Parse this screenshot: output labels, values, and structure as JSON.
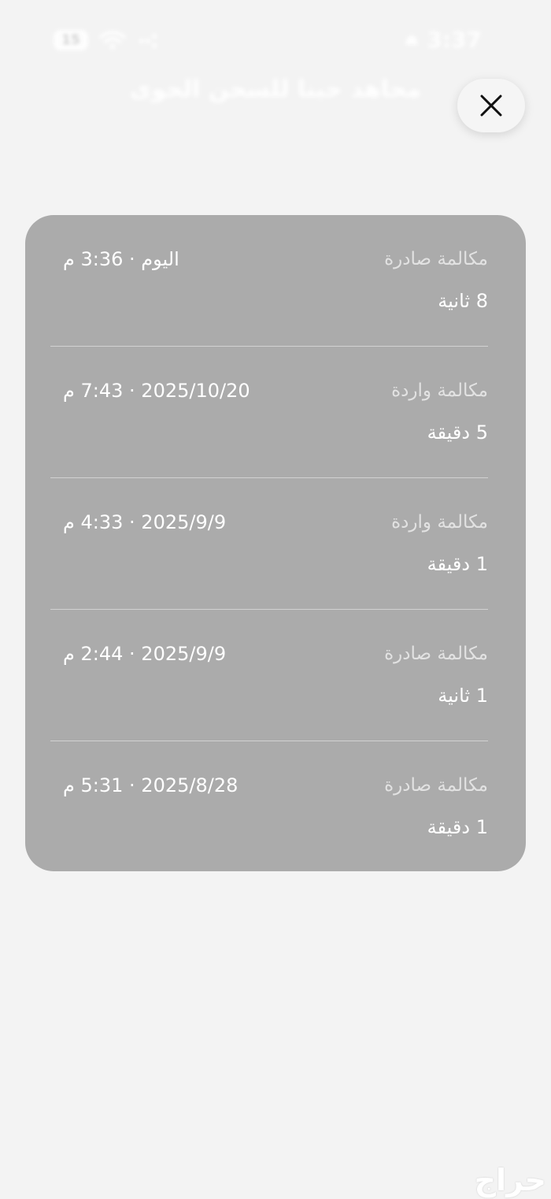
{
  "status_bar": {
    "time": "3:37",
    "battery": "15"
  },
  "contact": {
    "name": "محاهد حبنا للسحن الحوى",
    "subtitle": ""
  },
  "calls": [
    {
      "type": "مكالمة صادرة",
      "datetime": "اليوم · 3:36 م",
      "duration": "8 ثانية"
    },
    {
      "type": "مكالمة واردة",
      "datetime": "2025/10/20 · 7:43 م",
      "duration": "5 دقيقة"
    },
    {
      "type": "مكالمة واردة",
      "datetime": "2025/9/9 · 4:33 م",
      "duration": "1 دقيقة"
    },
    {
      "type": "مكالمة صادرة",
      "datetime": "2025/9/9 · 2:44 م",
      "duration": "1 ثانية"
    },
    {
      "type": "مكالمة صادرة",
      "datetime": "2025/8/28 · 5:31 م",
      "duration": "1 دقيقة"
    }
  ],
  "icons": {
    "close": "close-icon",
    "wifi": "wifi-icon",
    "battery": "battery-icon"
  },
  "watermark": "حراج",
  "colors": {
    "background": "#f3f3f3",
    "card": "#ababab",
    "divider": "#d2d2d2"
  }
}
